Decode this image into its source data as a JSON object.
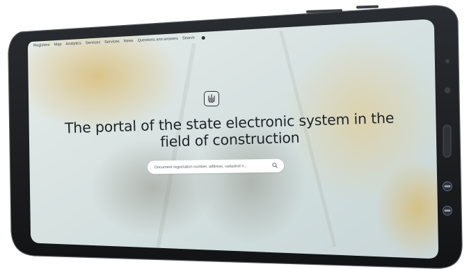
{
  "nav": {
    "items": [
      "Registers",
      "Map",
      "Analytics",
      "Services",
      "Services",
      "News",
      "Questions and answers",
      "Search"
    ]
  },
  "hero": {
    "title": "The portal of the state electronic system in the field of construction"
  },
  "search": {
    "placeholder": "Document registration number, address, cadastral n..."
  },
  "icons": {
    "emblem": "trident-emblem-icon",
    "search": "search-icon",
    "theme": "theme-toggle-icon"
  },
  "colors": {
    "frame": "#1b1d20",
    "text": "#1e2328",
    "screen_bg": "#dbe4e4"
  }
}
